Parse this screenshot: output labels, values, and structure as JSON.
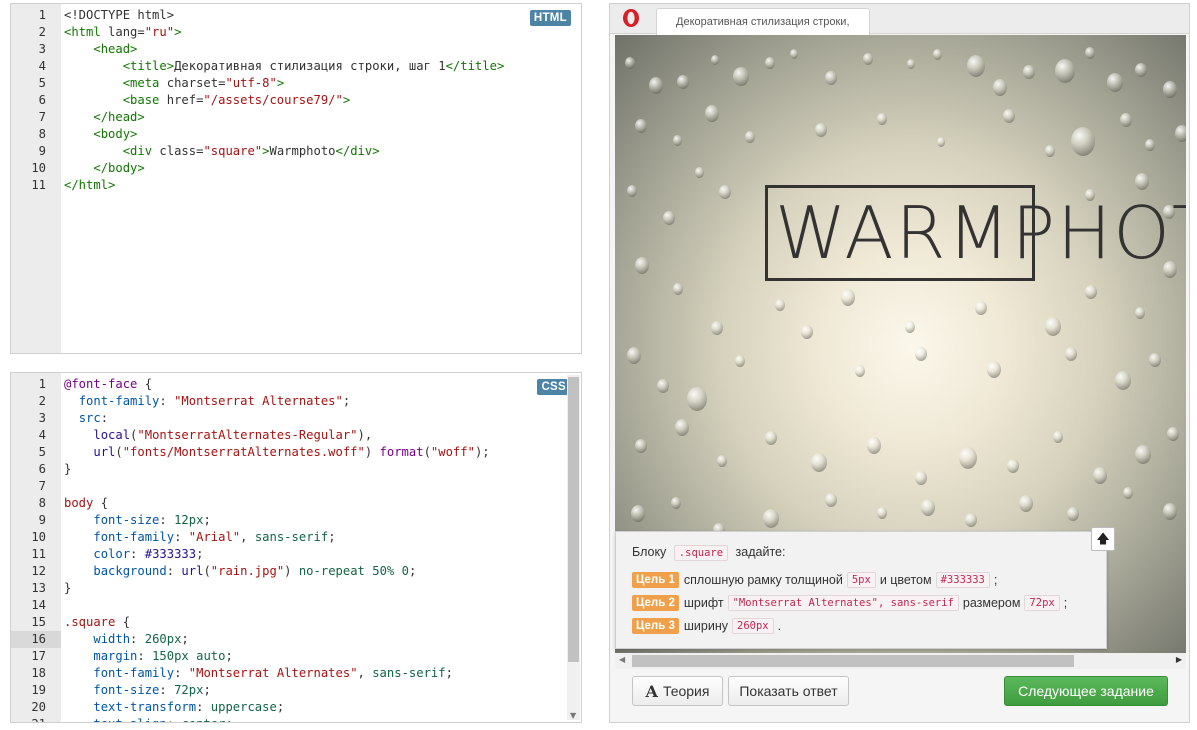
{
  "html_editor": {
    "badge": "HTML",
    "lines": [
      {
        "n": "1",
        "parts": [
          [
            "t-doc",
            "<!DOCTYPE html>"
          ]
        ]
      },
      {
        "n": "2",
        "parts": [
          [
            "t-tag",
            "<html"
          ],
          [
            "t-attr",
            " lang="
          ],
          [
            "t-str",
            "\"ru\""
          ],
          [
            "t-tag",
            ">"
          ]
        ]
      },
      {
        "n": "3",
        "parts": [
          [
            "t-plain",
            "    "
          ],
          [
            "t-tag",
            "<head>"
          ]
        ]
      },
      {
        "n": "4",
        "parts": [
          [
            "t-plain",
            "        "
          ],
          [
            "t-tag",
            "<title>"
          ],
          [
            "t-plain",
            "Декоративная стилизация строки, шаг 1"
          ],
          [
            "t-tag",
            "</title>"
          ]
        ]
      },
      {
        "n": "5",
        "parts": [
          [
            "t-plain",
            "        "
          ],
          [
            "t-tag",
            "<meta"
          ],
          [
            "t-attr",
            " charset="
          ],
          [
            "t-str",
            "\"utf-8\""
          ],
          [
            "t-tag",
            ">"
          ]
        ]
      },
      {
        "n": "6",
        "parts": [
          [
            "t-plain",
            "        "
          ],
          [
            "t-tag",
            "<base"
          ],
          [
            "t-attr",
            " href="
          ],
          [
            "t-str",
            "\"/assets/course79/\""
          ],
          [
            "t-tag",
            ">"
          ]
        ]
      },
      {
        "n": "7",
        "parts": [
          [
            "t-plain",
            "    "
          ],
          [
            "t-tag",
            "</head>"
          ]
        ]
      },
      {
        "n": "8",
        "parts": [
          [
            "t-plain",
            "    "
          ],
          [
            "t-tag",
            "<body>"
          ]
        ]
      },
      {
        "n": "9",
        "parts": [
          [
            "t-plain",
            "        "
          ],
          [
            "t-tag",
            "<div"
          ],
          [
            "t-attr",
            " class="
          ],
          [
            "t-str",
            "\"square\""
          ],
          [
            "t-tag",
            ">"
          ],
          [
            "t-plain",
            "Warmphoto"
          ],
          [
            "t-tag",
            "</div>"
          ]
        ]
      },
      {
        "n": "10",
        "parts": [
          [
            "t-plain",
            "    "
          ],
          [
            "t-tag",
            "</body>"
          ]
        ]
      },
      {
        "n": "11",
        "parts": [
          [
            "t-tag",
            "</html>"
          ]
        ]
      }
    ]
  },
  "css_editor": {
    "badge": "CSS",
    "active_line": "16",
    "lines": [
      {
        "n": "1",
        "parts": [
          [
            "t-kw",
            "@font-face"
          ],
          [
            "t-brace",
            " {"
          ]
        ]
      },
      {
        "n": "2",
        "parts": [
          [
            "t-plain",
            "  "
          ],
          [
            "t-prop",
            "font-family"
          ],
          [
            "t-plain",
            ": "
          ],
          [
            "t-str",
            "\"Montserrat Alternates\""
          ],
          [
            "t-plain",
            ";"
          ]
        ]
      },
      {
        "n": "3",
        "parts": [
          [
            "t-plain",
            "  "
          ],
          [
            "t-prop",
            "src"
          ],
          [
            "t-plain",
            ":"
          ]
        ]
      },
      {
        "n": "4",
        "parts": [
          [
            "t-plain",
            "    "
          ],
          [
            "t-atom",
            "local"
          ],
          [
            "t-plain",
            "("
          ],
          [
            "t-str",
            "\"MontserratAlternates-Regular\""
          ],
          [
            "t-plain",
            "),"
          ]
        ]
      },
      {
        "n": "5",
        "parts": [
          [
            "t-plain",
            "    "
          ],
          [
            "t-atom",
            "url"
          ],
          [
            "t-plain",
            "("
          ],
          [
            "t-str",
            "\"fonts/MontserratAlternates.woff\""
          ],
          [
            "t-plain",
            ") "
          ],
          [
            "t-kw",
            "format"
          ],
          [
            "t-plain",
            "("
          ],
          [
            "t-str",
            "\"woff\""
          ],
          [
            "t-plain",
            ");"
          ]
        ]
      },
      {
        "n": "6",
        "parts": [
          [
            "t-brace",
            "}"
          ]
        ]
      },
      {
        "n": "7",
        "parts": []
      },
      {
        "n": "8",
        "parts": [
          [
            "t-sel",
            "body"
          ],
          [
            "t-brace",
            " {"
          ]
        ]
      },
      {
        "n": "9",
        "parts": [
          [
            "t-plain",
            "    "
          ],
          [
            "t-prop",
            "font-size"
          ],
          [
            "t-plain",
            ": "
          ],
          [
            "t-num",
            "12px"
          ],
          [
            "t-plain",
            ";"
          ]
        ]
      },
      {
        "n": "10",
        "parts": [
          [
            "t-plain",
            "    "
          ],
          [
            "t-prop",
            "font-family"
          ],
          [
            "t-plain",
            ": "
          ],
          [
            "t-str",
            "\"Arial\""
          ],
          [
            "t-plain",
            ", "
          ],
          [
            "t-num",
            "sans-serif"
          ],
          [
            "t-plain",
            ";"
          ]
        ]
      },
      {
        "n": "11",
        "parts": [
          [
            "t-plain",
            "    "
          ],
          [
            "t-prop",
            "color"
          ],
          [
            "t-plain",
            ": "
          ],
          [
            "t-atom",
            "#333333"
          ],
          [
            "t-plain",
            ";"
          ]
        ]
      },
      {
        "n": "12",
        "parts": [
          [
            "t-plain",
            "    "
          ],
          [
            "t-prop",
            "background"
          ],
          [
            "t-plain",
            ": "
          ],
          [
            "t-atom",
            "url"
          ],
          [
            "t-plain",
            "("
          ],
          [
            "t-str",
            "\"rain.jpg\""
          ],
          [
            "t-plain",
            ") "
          ],
          [
            "t-num",
            "no-repeat"
          ],
          [
            "t-plain",
            " "
          ],
          [
            "t-num",
            "50%"
          ],
          [
            "t-plain",
            " "
          ],
          [
            "t-num",
            "0"
          ],
          [
            "t-plain",
            ";"
          ]
        ]
      },
      {
        "n": "13",
        "parts": [
          [
            "t-brace",
            "}"
          ]
        ]
      },
      {
        "n": "14",
        "parts": []
      },
      {
        "n": "15",
        "parts": [
          [
            "t-sel",
            ".square"
          ],
          [
            "t-brace",
            " {"
          ]
        ]
      },
      {
        "n": "16",
        "parts": [
          [
            "t-plain",
            "    "
          ],
          [
            "t-prop",
            "width"
          ],
          [
            "t-plain",
            ": "
          ],
          [
            "t-num",
            "260px"
          ],
          [
            "t-plain",
            ";"
          ]
        ]
      },
      {
        "n": "17",
        "parts": [
          [
            "t-plain",
            "    "
          ],
          [
            "t-prop",
            "margin"
          ],
          [
            "t-plain",
            ": "
          ],
          [
            "t-num",
            "150px"
          ],
          [
            "t-plain",
            " "
          ],
          [
            "t-num",
            "auto"
          ],
          [
            "t-plain",
            ";"
          ]
        ]
      },
      {
        "n": "18",
        "parts": [
          [
            "t-plain",
            "    "
          ],
          [
            "t-prop",
            "font-family"
          ],
          [
            "t-plain",
            ": "
          ],
          [
            "t-str",
            "\"Montserrat Alternates\""
          ],
          [
            "t-plain",
            ", "
          ],
          [
            "t-num",
            "sans-serif"
          ],
          [
            "t-plain",
            ";"
          ]
        ]
      },
      {
        "n": "19",
        "parts": [
          [
            "t-plain",
            "    "
          ],
          [
            "t-prop",
            "font-size"
          ],
          [
            "t-plain",
            ": "
          ],
          [
            "t-num",
            "72px"
          ],
          [
            "t-plain",
            ";"
          ]
        ]
      },
      {
        "n": "20",
        "parts": [
          [
            "t-plain",
            "    "
          ],
          [
            "t-prop",
            "text-transform"
          ],
          [
            "t-plain",
            ": "
          ],
          [
            "t-num",
            "uppercase"
          ],
          [
            "t-plain",
            ";"
          ]
        ]
      },
      {
        "n": "21",
        "parts": [
          [
            "t-plain",
            "    "
          ],
          [
            "t-prop",
            "text-align"
          ],
          [
            "t-plain",
            ": "
          ],
          [
            "t-num",
            "center"
          ],
          [
            "t-plain",
            ";"
          ]
        ]
      }
    ]
  },
  "preview": {
    "tab_title": "Декоративная стилизация строки,",
    "square_text": "WARMPHOTO"
  },
  "task": {
    "intro_before": "Блоку",
    "intro_selector": ".square",
    "intro_after": "задайте:",
    "goals": [
      {
        "label": "Цель 1",
        "before": "сплошную рамку толщиной",
        "pill1": "5px",
        "middle": "и цветом",
        "pill2": "#333333",
        "after": ";"
      },
      {
        "label": "Цель 2",
        "before": "шрифт",
        "pill1": "\"Montserrat Alternates\", sans-serif",
        "middle": "размером",
        "pill2": "72px",
        "after": ";"
      },
      {
        "label": "Цель 3",
        "before": "ширину",
        "pill1": "260px",
        "middle": "",
        "pill2": "",
        "after": "."
      }
    ],
    "up_icon": "arrow-up-icon"
  },
  "buttons": {
    "theory_icon": "A",
    "theory": "Теория",
    "show_answer": "Показать ответ",
    "next": "Следующее задание"
  },
  "colors": {
    "accent_green": "#4cae4c",
    "goal_orange": "#f0a04b",
    "badge_blue": "#4d84a6"
  }
}
